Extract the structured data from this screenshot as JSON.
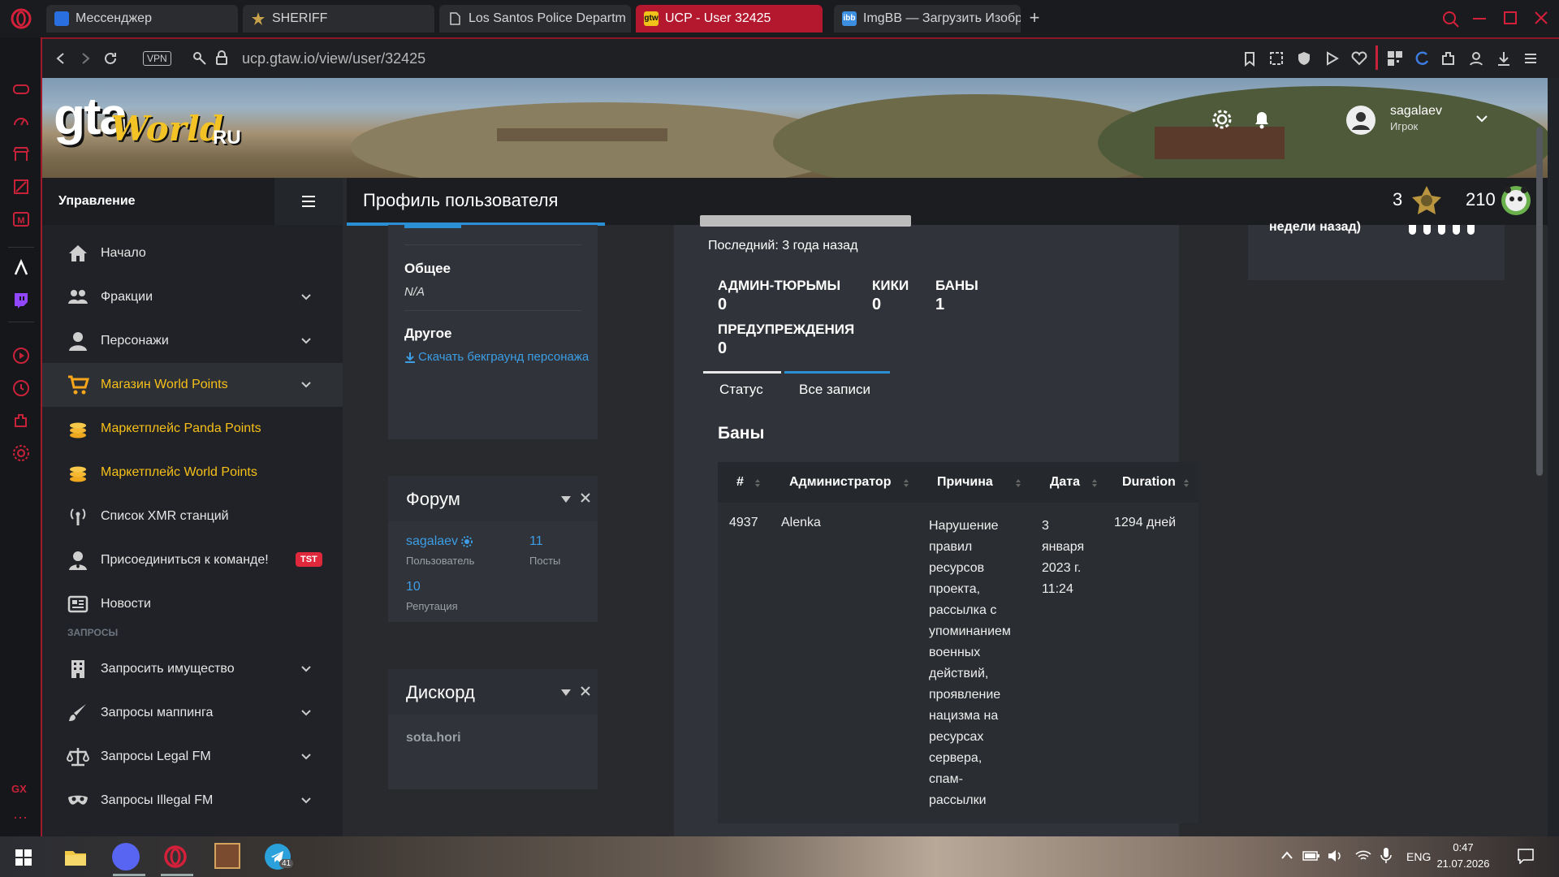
{
  "browser": {
    "tabs": [
      {
        "label": "Мессенджер"
      },
      {
        "label": "SHERIFF"
      },
      {
        "label": "Los Santos Police Departm"
      },
      {
        "label": "UCP - User 32425"
      },
      {
        "label": "ImgBB — Загрузить Изобр"
      }
    ],
    "url": "ucp.gtaw.io/view/user/32425",
    "vpn": "VPN"
  },
  "site": {
    "logo_main": "gta",
    "logo_script": "World",
    "logo_ru": "RU",
    "user_name": "sagalaev",
    "user_role": "Игрок"
  },
  "sidebar": {
    "title": "Управление",
    "items": [
      {
        "label": "Начало"
      },
      {
        "label": "Фракции"
      },
      {
        "label": "Персонажи"
      },
      {
        "label": "Магазин World Points"
      },
      {
        "label": "Маркетплейс Panda Points"
      },
      {
        "label": "Маркетплейс World Points"
      },
      {
        "label": "Список XMR станций"
      },
      {
        "label": "Присоединиться к команде!",
        "badge": "TST"
      },
      {
        "label": "Новости"
      }
    ],
    "section": "ЗАПРОСЫ",
    "requests": [
      {
        "label": "Запросить имущество"
      },
      {
        "label": "Запросы маппинга"
      },
      {
        "label": "Запросы Legal FM"
      },
      {
        "label": "Запросы Illegal FM"
      }
    ]
  },
  "header": {
    "title": "Профиль пользователя",
    "points_a": "3",
    "points_b": "210"
  },
  "profile": {
    "general_label": "Общее",
    "general_value": "N/A",
    "other_label": "Другое",
    "download_link": "Скачать бекграунд персонажа"
  },
  "forum": {
    "title": "Форум",
    "user": "sagalaev",
    "user_label": "Пользователь",
    "posts": "11",
    "posts_label": "Посты",
    "rep": "10",
    "rep_label": "Репутация"
  },
  "discord": {
    "title": "Дискорд",
    "value": "sota.hori"
  },
  "records": {
    "last": "Последний: 3 года назад",
    "stats": [
      {
        "label": "АДМИН-ТЮРЬМЫ",
        "value": "0"
      },
      {
        "label": "КИКИ",
        "value": "0"
      },
      {
        "label": "БАНЫ",
        "value": "1"
      },
      {
        "label": "ПРЕДУПРЕЖДЕНИЯ",
        "value": "0"
      }
    ],
    "tabs": [
      "Статус",
      "Все записи"
    ],
    "bans_title": "Баны",
    "columns": [
      "#",
      "Администратор",
      "Причина",
      "Дата",
      "Duration"
    ],
    "rows": [
      {
        "id": "4937",
        "admin": "Alenka",
        "reason_lines": [
          "Нарушение",
          "правил",
          "ресурсов",
          "проекта,",
          "рассылка с",
          "упоминанием",
          "военных",
          "действий,",
          "проявление",
          "нацизма на",
          "ресурсах",
          "сервера,",
          "спам-",
          "рассылки"
        ],
        "date_lines": [
          "3",
          "января",
          "2023 г.",
          "11:24"
        ],
        "duration": "1294 дней"
      }
    ]
  },
  "right_panel": {
    "partial_text": "недели назад)"
  },
  "taskbar": {
    "lang": "ENG",
    "time": "0:47",
    "date": "21.07.2026",
    "telegram_badge": "41"
  }
}
